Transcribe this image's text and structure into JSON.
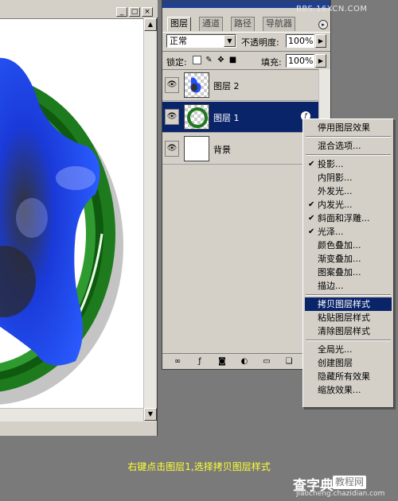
{
  "watermark_brand": "BBS.16XCN.COM",
  "document_window": {
    "titlebar_buttons": [
      "_",
      "□",
      "×"
    ],
    "scroll_up": "▲",
    "scroll_down": "▼"
  },
  "layers_panel": {
    "tabs": [
      {
        "label": "图层",
        "active": true
      },
      {
        "label": "通道",
        "active": false
      },
      {
        "label": "路径",
        "active": false
      },
      {
        "label": "导航器",
        "active": false
      }
    ],
    "menu_button": "▸",
    "blend_mode": "正常",
    "opacity_label": "不透明度:",
    "opacity_value": "100%",
    "lock_label": "锁定:",
    "lock_icons": [
      "lock-transparent-icon",
      "lock-paint-icon",
      "lock-move-icon",
      "lock-all-icon"
    ],
    "fill_label": "填充:",
    "fill_value": "100%",
    "layers": [
      {
        "name": "图层 2",
        "visible": true,
        "selected": false
      },
      {
        "name": "图层 1",
        "visible": true,
        "selected": true,
        "has_fx": true
      },
      {
        "name": "背景",
        "visible": true,
        "selected": false
      }
    ],
    "bottom_icons": [
      "link-layers-icon",
      "add-style-icon",
      "add-mask-icon",
      "adjustment-layer-icon",
      "new-folder-icon",
      "new-layer-icon",
      "delete-layer-icon"
    ]
  },
  "context_menu": {
    "groups": [
      [
        {
          "label": "停用图层效果",
          "checked": false
        }
      ],
      [
        {
          "label": "混合选项...",
          "checked": false
        }
      ],
      [
        {
          "label": "投影...",
          "checked": true
        },
        {
          "label": "内阴影...",
          "checked": false
        },
        {
          "label": "外发光...",
          "checked": false
        },
        {
          "label": "内发光...",
          "checked": true
        },
        {
          "label": "斜面和浮雕...",
          "checked": true
        },
        {
          "label": "光泽...",
          "checked": true
        },
        {
          "label": "颜色叠加...",
          "checked": false
        },
        {
          "label": "渐变叠加...",
          "checked": false
        },
        {
          "label": "图案叠加...",
          "checked": false
        },
        {
          "label": "描边...",
          "checked": false
        }
      ],
      [
        {
          "label": "拷贝图层样式",
          "checked": false,
          "highlighted": true
        },
        {
          "label": "粘贴图层样式",
          "checked": false
        },
        {
          "label": "清除图层样式",
          "checked": false
        }
      ],
      [
        {
          "label": "全局光...",
          "checked": false
        },
        {
          "label": "创建图层",
          "checked": false
        },
        {
          "label": "隐藏所有效果",
          "checked": false
        },
        {
          "label": "缩放效果...",
          "checked": false
        }
      ]
    ]
  },
  "caption": "右键点击图层1,选择拷贝图层样式",
  "site_watermark": {
    "name": "查字典",
    "badge": "教程网",
    "url": "jiaocheng.chazidian.com"
  },
  "colors": {
    "selection": "#0a246a",
    "caption": "#ffff33",
    "ring_green": "#1f7a1f",
    "shape_blue": "#1f4fff"
  }
}
